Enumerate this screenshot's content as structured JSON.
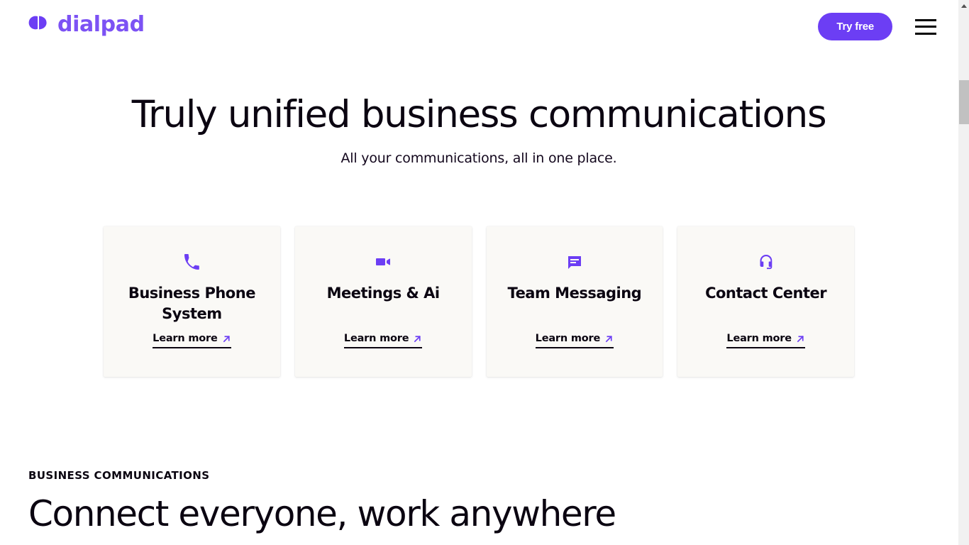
{
  "header": {
    "brand_name": "dialpad",
    "brand_mark_icon": "dialpad-logo-mark",
    "try_free_label": "Try free",
    "menu_icon": "hamburger-menu-icon"
  },
  "hero": {
    "title": "Truly unified business communications",
    "subtitle": "All your communications, all in one place."
  },
  "cards": [
    {
      "icon": "phone-icon",
      "title": "Business Phone System",
      "link_label": "Learn more",
      "link_arrow_icon": "arrow-up-right-icon"
    },
    {
      "icon": "video-camera-icon",
      "title": "Meetings & Ai",
      "link_label": "Learn more",
      "link_arrow_icon": "arrow-up-right-icon"
    },
    {
      "icon": "chat-bubble-icon",
      "title": "Team Messaging",
      "link_label": "Learn more",
      "link_arrow_icon": "arrow-up-right-icon"
    },
    {
      "icon": "headset-icon",
      "title": "Contact Center",
      "link_label": "Learn more",
      "link_arrow_icon": "arrow-up-right-icon"
    }
  ],
  "bottom_section": {
    "eyebrow": "BUSINESS COMMUNICATIONS",
    "heading": "Connect everyone, work anywhere"
  },
  "colors": {
    "accent_purple": "#6C3EF4",
    "brand_purple": "#7C52F4",
    "card_background": "#FAF9F6",
    "page_background": "#FFFFFF",
    "text_dark": "#0B0511",
    "scrollbar_thumb": "#C1C1C1",
    "scrollbar_track": "#F1F1F1"
  }
}
